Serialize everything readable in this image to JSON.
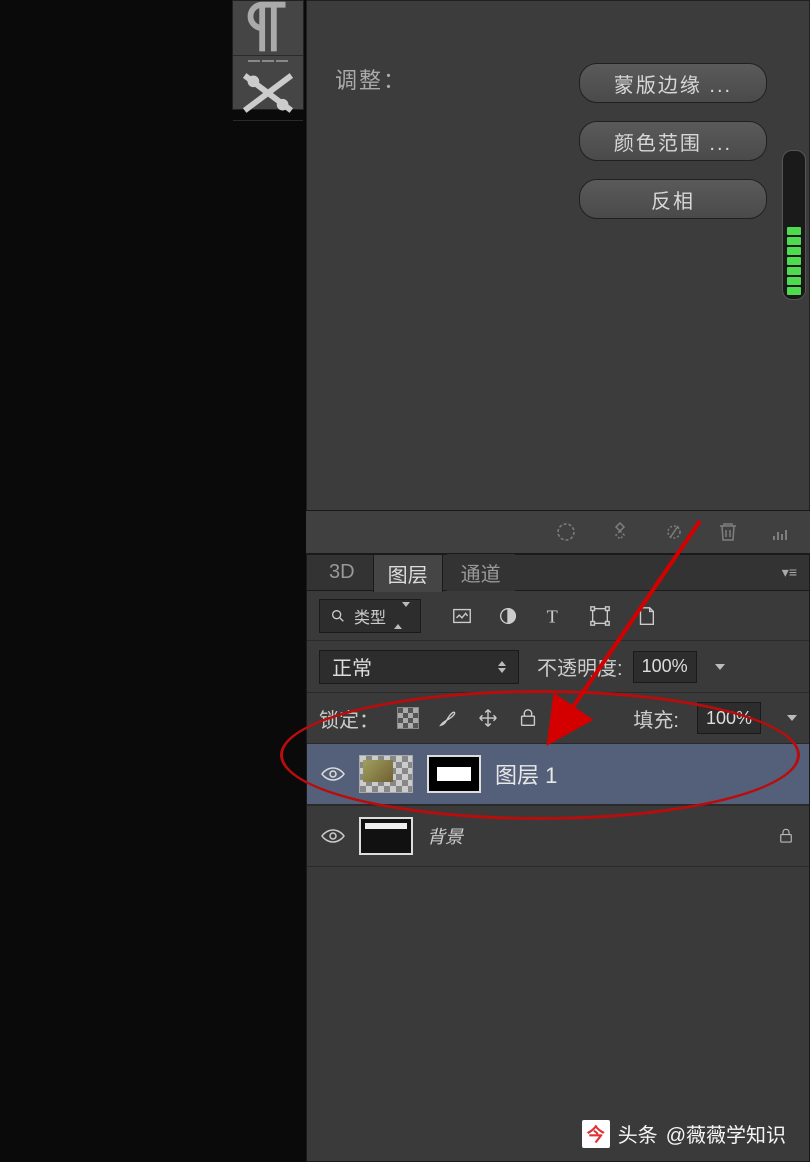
{
  "adjust_section": {
    "label": "调整：",
    "buttons": {
      "mask_edge": "蒙版边缘 ...",
      "color_range": "颜色范围 ...",
      "invert": "反相"
    }
  },
  "tabs": {
    "three_d": "3D",
    "layers": "图层",
    "channels": "通道"
  },
  "filter": {
    "type_label": "类型"
  },
  "blend": {
    "mode": "正常",
    "opacity_label": "不透明度:",
    "opacity_value": "100%"
  },
  "lock": {
    "label": "锁定：",
    "fill_label": "填充:",
    "fill_value": "100%"
  },
  "layers": {
    "layer1_name": "图层 1",
    "background_name": "背景"
  },
  "watermark": {
    "prefix": "头条",
    "author": "@薇薇学知识"
  }
}
